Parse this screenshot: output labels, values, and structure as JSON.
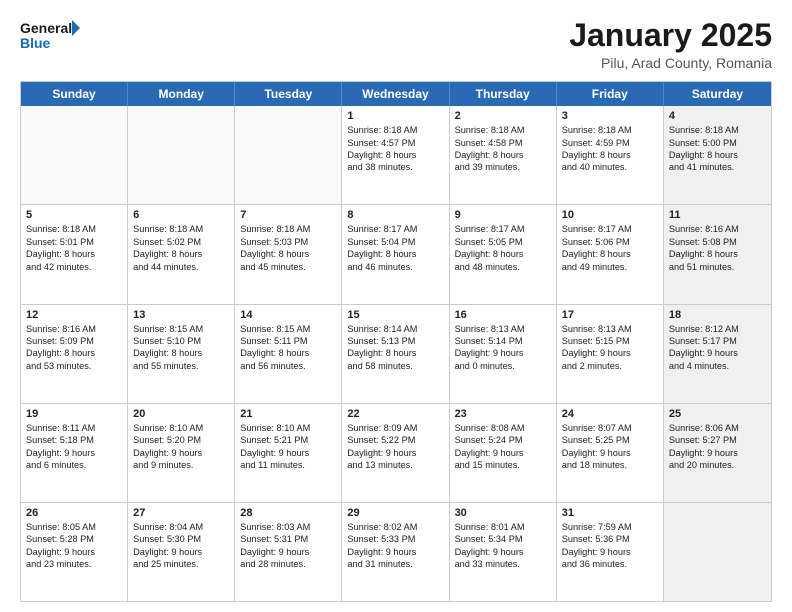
{
  "header": {
    "logo_line1": "General",
    "logo_line2": "Blue",
    "title": "January 2025",
    "subtitle": "Pilu, Arad County, Romania"
  },
  "days_of_week": [
    "Sunday",
    "Monday",
    "Tuesday",
    "Wednesday",
    "Thursday",
    "Friday",
    "Saturday"
  ],
  "weeks": [
    [
      {
        "day": "",
        "info": "",
        "empty": true
      },
      {
        "day": "",
        "info": "",
        "empty": true
      },
      {
        "day": "",
        "info": "",
        "empty": true
      },
      {
        "day": "1",
        "info": "Sunrise: 8:18 AM\nSunset: 4:57 PM\nDaylight: 8 hours\nand 38 minutes.",
        "empty": false
      },
      {
        "day": "2",
        "info": "Sunrise: 8:18 AM\nSunset: 4:58 PM\nDaylight: 8 hours\nand 39 minutes.",
        "empty": false
      },
      {
        "day": "3",
        "info": "Sunrise: 8:18 AM\nSunset: 4:59 PM\nDaylight: 8 hours\nand 40 minutes.",
        "empty": false
      },
      {
        "day": "4",
        "info": "Sunrise: 8:18 AM\nSunset: 5:00 PM\nDaylight: 8 hours\nand 41 minutes.",
        "empty": false,
        "shaded": true
      }
    ],
    [
      {
        "day": "5",
        "info": "Sunrise: 8:18 AM\nSunset: 5:01 PM\nDaylight: 8 hours\nand 42 minutes.",
        "empty": false
      },
      {
        "day": "6",
        "info": "Sunrise: 8:18 AM\nSunset: 5:02 PM\nDaylight: 8 hours\nand 44 minutes.",
        "empty": false
      },
      {
        "day": "7",
        "info": "Sunrise: 8:18 AM\nSunset: 5:03 PM\nDaylight: 8 hours\nand 45 minutes.",
        "empty": false
      },
      {
        "day": "8",
        "info": "Sunrise: 8:17 AM\nSunset: 5:04 PM\nDaylight: 8 hours\nand 46 minutes.",
        "empty": false
      },
      {
        "day": "9",
        "info": "Sunrise: 8:17 AM\nSunset: 5:05 PM\nDaylight: 8 hours\nand 48 minutes.",
        "empty": false
      },
      {
        "day": "10",
        "info": "Sunrise: 8:17 AM\nSunset: 5:06 PM\nDaylight: 8 hours\nand 49 minutes.",
        "empty": false
      },
      {
        "day": "11",
        "info": "Sunrise: 8:16 AM\nSunset: 5:08 PM\nDaylight: 8 hours\nand 51 minutes.",
        "empty": false,
        "shaded": true
      }
    ],
    [
      {
        "day": "12",
        "info": "Sunrise: 8:16 AM\nSunset: 5:09 PM\nDaylight: 8 hours\nand 53 minutes.",
        "empty": false
      },
      {
        "day": "13",
        "info": "Sunrise: 8:15 AM\nSunset: 5:10 PM\nDaylight: 8 hours\nand 55 minutes.",
        "empty": false
      },
      {
        "day": "14",
        "info": "Sunrise: 8:15 AM\nSunset: 5:11 PM\nDaylight: 8 hours\nand 56 minutes.",
        "empty": false
      },
      {
        "day": "15",
        "info": "Sunrise: 8:14 AM\nSunset: 5:13 PM\nDaylight: 8 hours\nand 58 minutes.",
        "empty": false
      },
      {
        "day": "16",
        "info": "Sunrise: 8:13 AM\nSunset: 5:14 PM\nDaylight: 9 hours\nand 0 minutes.",
        "empty": false
      },
      {
        "day": "17",
        "info": "Sunrise: 8:13 AM\nSunset: 5:15 PM\nDaylight: 9 hours\nand 2 minutes.",
        "empty": false
      },
      {
        "day": "18",
        "info": "Sunrise: 8:12 AM\nSunset: 5:17 PM\nDaylight: 9 hours\nand 4 minutes.",
        "empty": false,
        "shaded": true
      }
    ],
    [
      {
        "day": "19",
        "info": "Sunrise: 8:11 AM\nSunset: 5:18 PM\nDaylight: 9 hours\nand 6 minutes.",
        "empty": false
      },
      {
        "day": "20",
        "info": "Sunrise: 8:10 AM\nSunset: 5:20 PM\nDaylight: 9 hours\nand 9 minutes.",
        "empty": false
      },
      {
        "day": "21",
        "info": "Sunrise: 8:10 AM\nSunset: 5:21 PM\nDaylight: 9 hours\nand 11 minutes.",
        "empty": false
      },
      {
        "day": "22",
        "info": "Sunrise: 8:09 AM\nSunset: 5:22 PM\nDaylight: 9 hours\nand 13 minutes.",
        "empty": false
      },
      {
        "day": "23",
        "info": "Sunrise: 8:08 AM\nSunset: 5:24 PM\nDaylight: 9 hours\nand 15 minutes.",
        "empty": false
      },
      {
        "day": "24",
        "info": "Sunrise: 8:07 AM\nSunset: 5:25 PM\nDaylight: 9 hours\nand 18 minutes.",
        "empty": false
      },
      {
        "day": "25",
        "info": "Sunrise: 8:06 AM\nSunset: 5:27 PM\nDaylight: 9 hours\nand 20 minutes.",
        "empty": false,
        "shaded": true
      }
    ],
    [
      {
        "day": "26",
        "info": "Sunrise: 8:05 AM\nSunset: 5:28 PM\nDaylight: 9 hours\nand 23 minutes.",
        "empty": false
      },
      {
        "day": "27",
        "info": "Sunrise: 8:04 AM\nSunset: 5:30 PM\nDaylight: 9 hours\nand 25 minutes.",
        "empty": false
      },
      {
        "day": "28",
        "info": "Sunrise: 8:03 AM\nSunset: 5:31 PM\nDaylight: 9 hours\nand 28 minutes.",
        "empty": false
      },
      {
        "day": "29",
        "info": "Sunrise: 8:02 AM\nSunset: 5:33 PM\nDaylight: 9 hours\nand 31 minutes.",
        "empty": false
      },
      {
        "day": "30",
        "info": "Sunrise: 8:01 AM\nSunset: 5:34 PM\nDaylight: 9 hours\nand 33 minutes.",
        "empty": false
      },
      {
        "day": "31",
        "info": "Sunrise: 7:59 AM\nSunset: 5:36 PM\nDaylight: 9 hours\nand 36 minutes.",
        "empty": false
      },
      {
        "day": "",
        "info": "",
        "empty": true,
        "shaded": true
      }
    ]
  ]
}
